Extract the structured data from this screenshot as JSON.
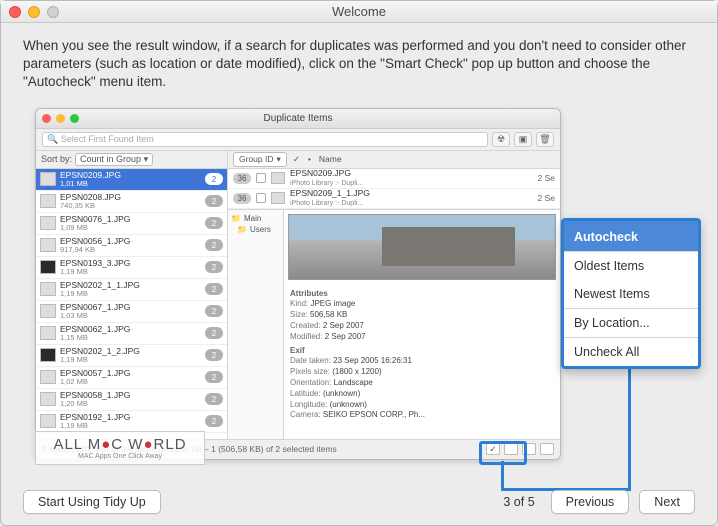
{
  "window": {
    "title": "Welcome"
  },
  "instruction": "When you see the result window, if a search for duplicates was performed and you don't need to consider other parameters (such as location or date modified), click on the \"Smart Check\" pop up button and choose the \"Autocheck\" menu item.",
  "screenshot": {
    "title": "Duplicate Items",
    "search_placeholder": "Select First Found Item",
    "sort_label": "Sort by:",
    "sort_value": "Count in Group",
    "group_btn": "Group ID",
    "name_col": "Name",
    "files": [
      {
        "name": "EPSN0209.JPG",
        "size": "1,01 MB",
        "count": "2",
        "sel": true,
        "dark": false
      },
      {
        "name": "EPSN0208.JPG",
        "size": "740,35 KB",
        "count": "2",
        "sel": false,
        "dark": false
      },
      {
        "name": "EPSN0076_1.JPG",
        "size": "1,09 MB",
        "count": "2",
        "sel": false,
        "dark": false
      },
      {
        "name": "EPSN0056_1.JPG",
        "size": "917,94 KB",
        "count": "2",
        "sel": false,
        "dark": false
      },
      {
        "name": "EPSN0193_3.JPG",
        "size": "1,19 MB",
        "count": "2",
        "sel": false,
        "dark": true
      },
      {
        "name": "EPSN0202_1_1.JPG",
        "size": "1,19 MB",
        "count": "2",
        "sel": false,
        "dark": false
      },
      {
        "name": "EPSN0067_1.JPG",
        "size": "1,03 MB",
        "count": "2",
        "sel": false,
        "dark": false
      },
      {
        "name": "EPSN0062_1.JPG",
        "size": "1,15 MB",
        "count": "2",
        "sel": false,
        "dark": false
      },
      {
        "name": "EPSN0202_1_2.JPG",
        "size": "1,19 MB",
        "count": "2",
        "sel": false,
        "dark": true
      },
      {
        "name": "EPSN0057_1.JPG",
        "size": "1,02 MB",
        "count": "2",
        "sel": false,
        "dark": false
      },
      {
        "name": "EPSN0058_1.JPG",
        "size": "1,20 MB",
        "count": "2",
        "sel": false,
        "dark": false
      },
      {
        "name": "EPSN0192_1.JPG",
        "size": "1,19 MB",
        "count": "2",
        "sel": false,
        "dark": false
      }
    ],
    "right_items": [
      {
        "gid": "36",
        "name": "EPSN0209.JPG",
        "sub": "iPhoto Library :- Dupli...",
        "date": "2 Se"
      },
      {
        "gid": "36",
        "name": "EPSN0209_1_1.JPG",
        "sub": "iPhoto Library :- Dupli...",
        "date": "2 Se"
      }
    ],
    "tree": {
      "main": "Main",
      "users": "Users"
    },
    "attrs": {
      "header": "Attributes",
      "kind_k": "Kind:",
      "kind_v": "JPEG image",
      "size_k": "Size:",
      "size_v": "506,58 KB",
      "created_k": "Created:",
      "created_v": "2 Sep 2007",
      "modified_k": "Modified:",
      "modified_v": "2 Sep 2007",
      "exif": "Exif",
      "taken_k": "Date taken:",
      "taken_v": "23 Sep 2005 16:26:31",
      "px_k": "Pixels size:",
      "px_v": "(1800 x 1200)",
      "orient_k": "Orientation:",
      "orient_v": "Landscape",
      "lat_k": "Latitude:",
      "lat_v": "(unknown)",
      "lon_k": "Longitude:",
      "lon_v": "(unknown)",
      "cam_k": "Camera:",
      "cam_v": "SEIKO EPSON CORP., Ph..."
    },
    "footer_text": "2 items (1,01 MB) of the same group in list – 1 (506,58 KB) of 2 selected items",
    "check_glyph": "✓"
  },
  "callout": {
    "autocheck": "Autocheck",
    "oldest": "Oldest Items",
    "newest": "Newest Items",
    "bylocation": "By Location...",
    "uncheck": "Uncheck All"
  },
  "watermark": {
    "text_pre": "ALL M",
    "text_post": "C W",
    "o": "●",
    "rest": "RLD",
    "sub": "MAC Apps One Click Away"
  },
  "footer": {
    "start": "Start Using Tidy Up",
    "page": "3 of 5",
    "previous": "Previous",
    "next": "Next"
  }
}
